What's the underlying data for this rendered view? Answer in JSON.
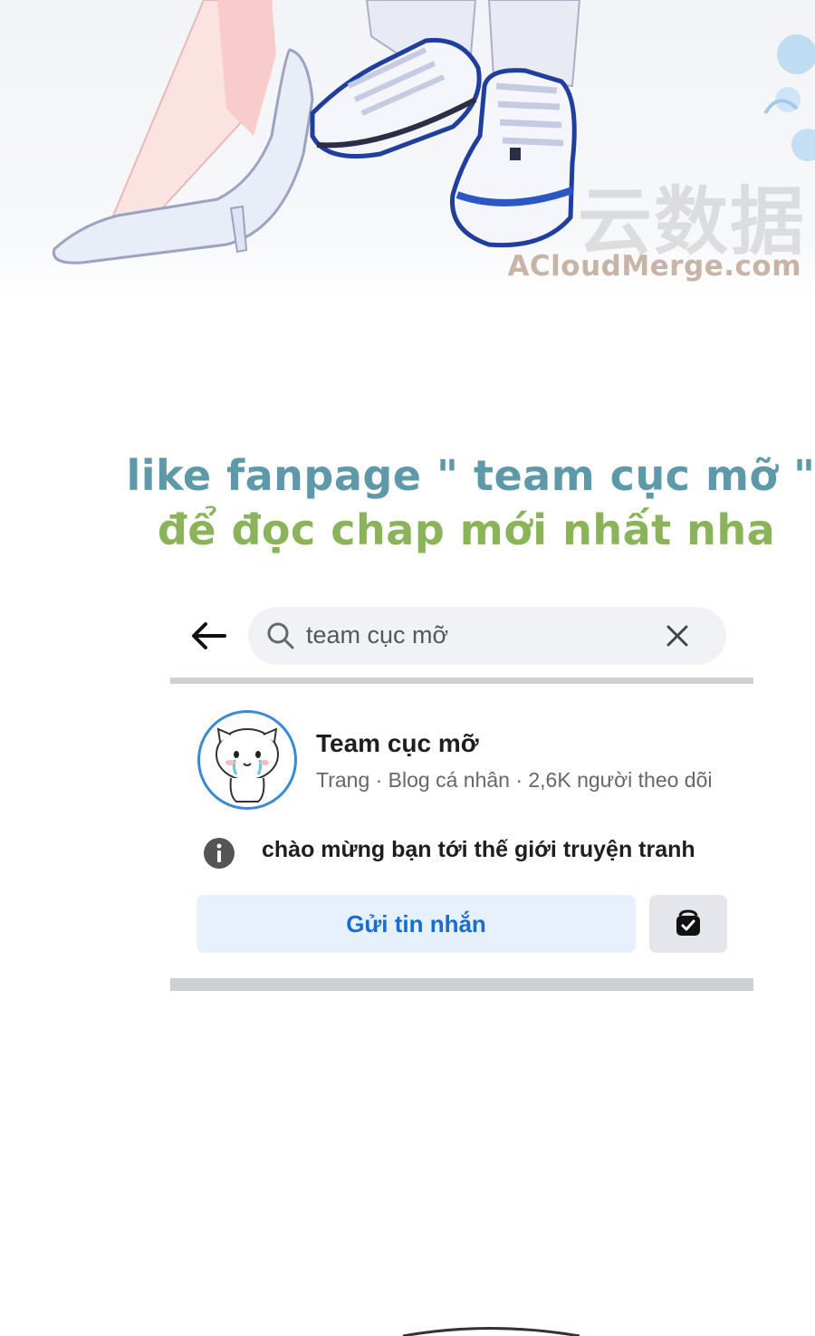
{
  "illustration": {
    "watermark_chinese": "云数据",
    "watermark_url": "ACloudMerge.com"
  },
  "promo": {
    "line1": "like fanpage \" team cục mỡ \"",
    "line2": "để đọc chap mới nhất nha",
    "colors": {
      "line1": "#5d99a8",
      "line2": "#8ab35a"
    }
  },
  "search": {
    "back_icon": "arrow-left-icon",
    "search_icon": "magnifier-icon",
    "query": "team cục mỡ",
    "clear_icon": "close-x-icon"
  },
  "result": {
    "avatar_icon": "cartoon-cat-avatar",
    "name": "Team cục mỡ",
    "meta": "Trang · Blog cá nhân · 2,6K người theo dõi",
    "info_icon": "info-circle-icon",
    "intro": "chào mừng bạn tới thế giới truyện tranh",
    "message_button": "Gửi tin nhắn",
    "shop_icon": "shop-bag-icon",
    "accent": "#1a6bd2"
  }
}
